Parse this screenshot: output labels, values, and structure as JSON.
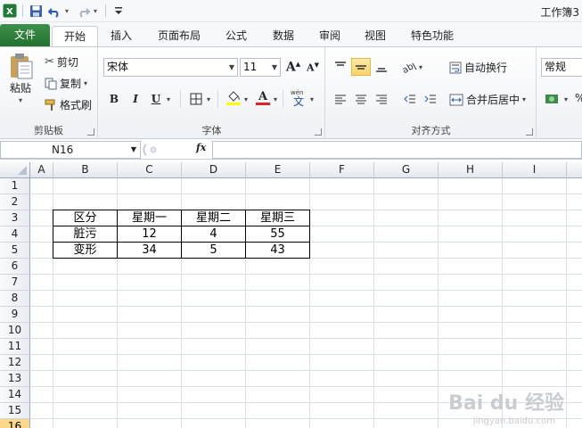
{
  "window": {
    "title": "工作簿3"
  },
  "tabs": [
    "文件",
    "开始",
    "插入",
    "页面布局",
    "公式",
    "数据",
    "审阅",
    "视图",
    "特色功能"
  ],
  "active_tab": "开始",
  "clipboard": {
    "paste": "粘贴",
    "cut": "剪切",
    "copy": "复制",
    "format_painter": "格式刷",
    "label": "剪贴板"
  },
  "font": {
    "name": "宋体",
    "size": "11",
    "bold": "B",
    "italic": "I",
    "underline": "U",
    "label": "字体"
  },
  "alignment": {
    "wrap": "自动换行",
    "merge": "合并后居中",
    "label": "对齐方式"
  },
  "number": {
    "format": "常规"
  },
  "formula_bar": {
    "name_box": "N16",
    "fx": "fx",
    "value": ""
  },
  "sheet": {
    "columns": [
      "A",
      "B",
      "C",
      "D",
      "E",
      "F",
      "G",
      "H",
      "I"
    ],
    "rows": [
      "1",
      "2",
      "3",
      "4",
      "5",
      "6",
      "7",
      "8",
      "9",
      "10",
      "11",
      "12",
      "13",
      "14",
      "15",
      "16"
    ],
    "selected_row": "16",
    "table": [
      [
        "区分",
        "星期一",
        "星期二",
        "星期三"
      ],
      [
        "脏污",
        "12",
        "4",
        "55"
      ],
      [
        "变形",
        "34",
        "5",
        "43"
      ]
    ]
  },
  "watermark": {
    "brand": "Bai du 经验",
    "url": "jingyan.baidu.com"
  },
  "colors": {
    "file_tab": "#2f7d3c",
    "selected_highlight": "#fbd364",
    "row_selected": "#fcd98a"
  }
}
